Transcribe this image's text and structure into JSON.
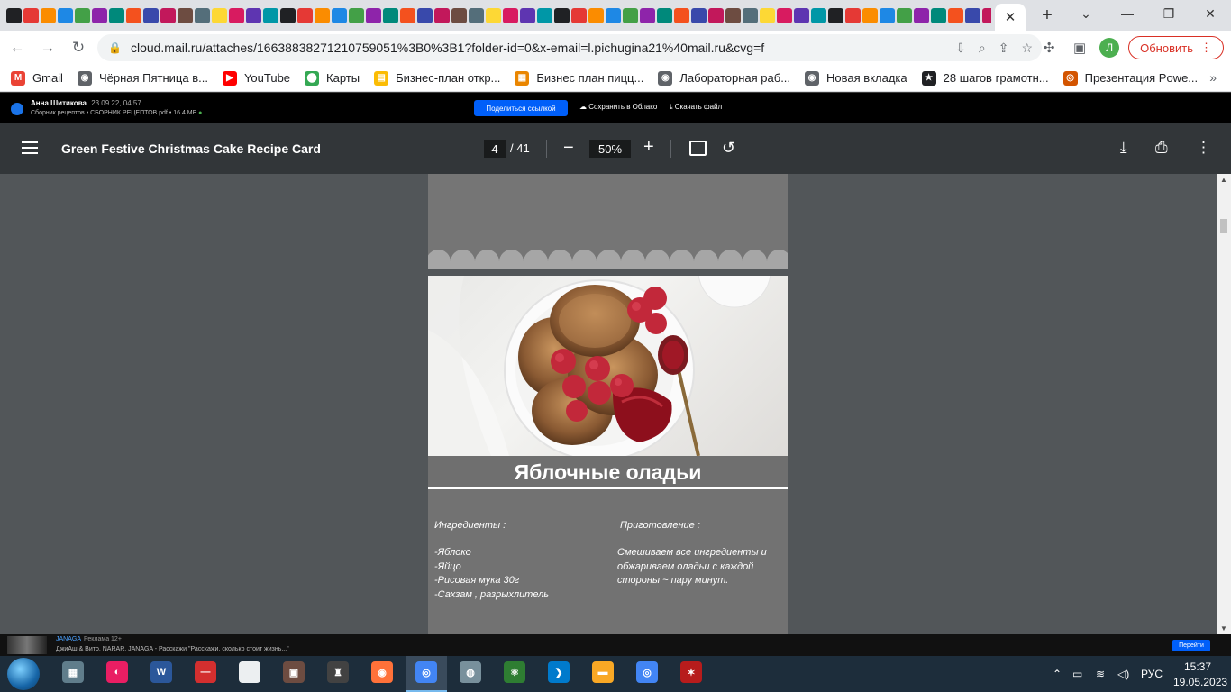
{
  "browser": {
    "active_tab_close": "✕",
    "new_tab": "+",
    "window_controls": [
      "⌄",
      "—",
      "❐",
      "✕"
    ],
    "url": "cloud.mail.ru/attaches/16638838271210759051%3B0%3B1?folder-id=0&x-email=l.pichugina21%40mail.ru&cvg=f",
    "profile_initial": "Л",
    "update_label": "Обновить",
    "bookmarks": [
      {
        "label": "Gmail",
        "icon": "gmail-icon",
        "color": "#ea4335",
        "glyph": "M"
      },
      {
        "label": "Чёрная Пятница в...",
        "icon": "globe-icon",
        "color": "#5f6368",
        "glyph": "◉"
      },
      {
        "label": "YouTube",
        "icon": "youtube-icon",
        "color": "#ff0000",
        "glyph": "▶"
      },
      {
        "label": "Карты",
        "icon": "maps-pin-icon",
        "color": "#34a853",
        "glyph": "⬤"
      },
      {
        "label": "Бизнес-план откр...",
        "icon": "document-icon",
        "color": "#fbbc04",
        "glyph": "▤"
      },
      {
        "label": "Бизнес план пицц...",
        "icon": "colorful-grid-icon",
        "color": "#ea8600",
        "glyph": "▦"
      },
      {
        "label": "Лабораторная раб...",
        "icon": "globe-icon",
        "color": "#5f6368",
        "glyph": "◉"
      },
      {
        "label": "Новая вкладка",
        "icon": "globe-icon",
        "color": "#5f6368",
        "glyph": "◉"
      },
      {
        "label": "28 шагов грамотн...",
        "icon": "star-icon",
        "color": "#202124",
        "glyph": "★"
      },
      {
        "label": "Презентация Powe...",
        "icon": "presentation-icon",
        "color": "#d35400",
        "glyph": "◎"
      }
    ],
    "bookmarks_more": "»"
  },
  "cloud": {
    "user_name": "Анна Шитикова",
    "date": "23.09.22, 04:57",
    "file_info": "Сборник рецептов • СБОРНИК РЕЦЕПТОВ.pdf • 16.4 МБ",
    "share_label": "Поделиться ссылкой",
    "save_label": "Сохранить в Облако",
    "download_label": "Скачать файл",
    "expand_icon": "⤢",
    "close_icon": "✕"
  },
  "pdf": {
    "title": "Green Festive Christmas Cake Recipe Card",
    "current_page": "4",
    "total_pages": "/ 41",
    "zoom": "50%"
  },
  "recipe": {
    "title": "Яблочные оладьи",
    "ingredients_heading": "Ингредиенты :",
    "ingredients": [
      "-Яблоко",
      "-Яйцо",
      "-Рисовая мука 30г",
      "-Сахзам , разрыхлитель"
    ],
    "steps_heading": "Приготовление :",
    "steps": [
      "Смешиваем все ингредиенты и",
      "обжариваем оладьи с каждой",
      "стороны ~ пару минут."
    ]
  },
  "ad": {
    "brand": "JANAGA",
    "badge": "Реклама 12+",
    "text": "ДжиАш & Витo, NARAR, JANAGA - Расскажи \"Расскажи, сколько стоит жизнь...\"",
    "button": "Перейти"
  },
  "taskbar": {
    "language": "РУС",
    "time": "15:37",
    "date": "19.05.2023"
  }
}
